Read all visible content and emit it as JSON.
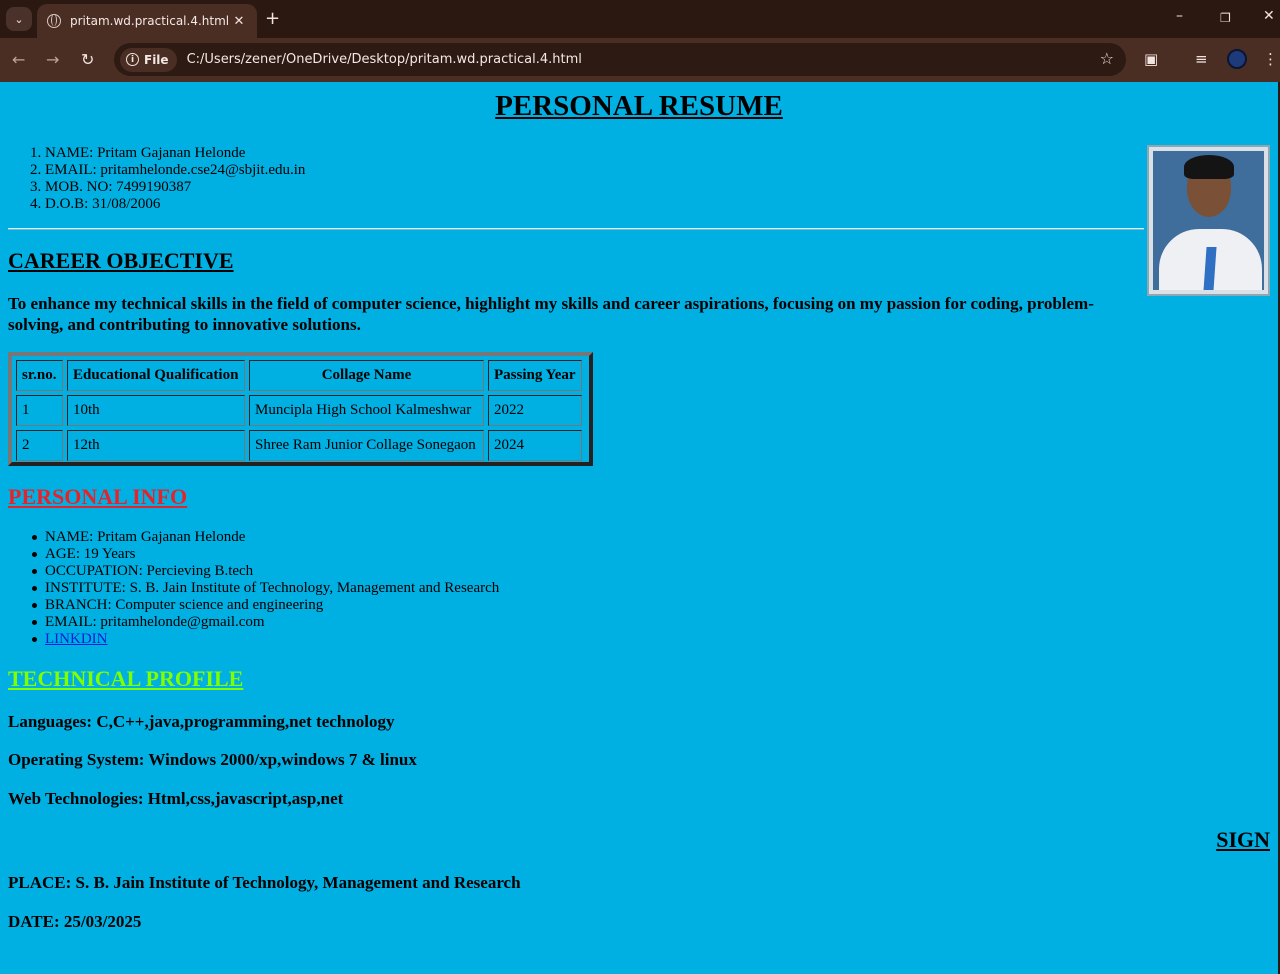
{
  "browser": {
    "tab_title": "pritam.wd.practical.4.html",
    "url_chip": "File",
    "url": "C:/Users/zener/OneDrive/Desktop/pritam.wd.practical.4.html"
  },
  "resume": {
    "title": "PERSONAL RESUME",
    "contact": [
      {
        "num": "1.",
        "text": "NAME: Pritam Gajanan Helonde"
      },
      {
        "num": "2.",
        "text": "EMAIL: pritamhelonde.cse24@sbjit.edu.in"
      },
      {
        "num": "3.",
        "text": "MOB. NO: 7499190387"
      },
      {
        "num": "4.",
        "text": "D.O.B: 31/08/2006"
      }
    ],
    "career": {
      "heading": "CAREER OBJECTIVE",
      "text": "To enhance my technical skills in the field of computer science, highlight my skills and career aspirations, focusing on my passion for coding, problem-solving, and contributing to innovative solutions."
    },
    "education": {
      "headers": [
        "sr.no.",
        "Educational Qualification",
        "Collage Name",
        "Passing Year"
      ],
      "rows": [
        [
          "1",
          "10th",
          "Muncipla High School Kalmeshwar",
          "2022"
        ],
        [
          "2",
          "12th",
          "Shree Ram Junior Collage Sonegaon",
          "2024"
        ]
      ]
    },
    "personal": {
      "heading": "PERSONAL INFO",
      "heading_color": "#e8222a",
      "items": [
        "NAME: Pritam Gajanan Helonde",
        "AGE: 19 Years",
        "OCCUPATION: Percieving B.tech",
        "INSTITUTE: S. B. Jain Institute of Technology, Management and Research",
        "BRANCH: Computer science and engineering",
        "EMAIL: pritamhelonde@gmail.com"
      ],
      "link_label": "LINKDIN"
    },
    "technical": {
      "heading": "TECHNICAL PROFILE",
      "heading_color": "#7fff00",
      "languages": "Languages: C,C++,java,programming,net technology",
      "os": "Operating System: Windows 2000/xp,windows 7 & linux",
      "web": "Web Technologies: Html,css,javascript,asp,net"
    },
    "sign": "SIGN",
    "place": "PLACE: S. B. Jain Institute of Technology, Management and Research",
    "date": "DATE: 25/03/2025"
  },
  "colors": {
    "page_bg": "#00b0e3",
    "link": "#0b1fd6"
  },
  "icons": [
    "tab-list-icon",
    "globe-icon",
    "close-icon",
    "plus-icon",
    "minimize-icon",
    "restore-icon",
    "back-icon",
    "forward-icon",
    "reload-icon",
    "info-icon",
    "star-icon",
    "extensions-icon",
    "media-icon",
    "avatar"
  ]
}
